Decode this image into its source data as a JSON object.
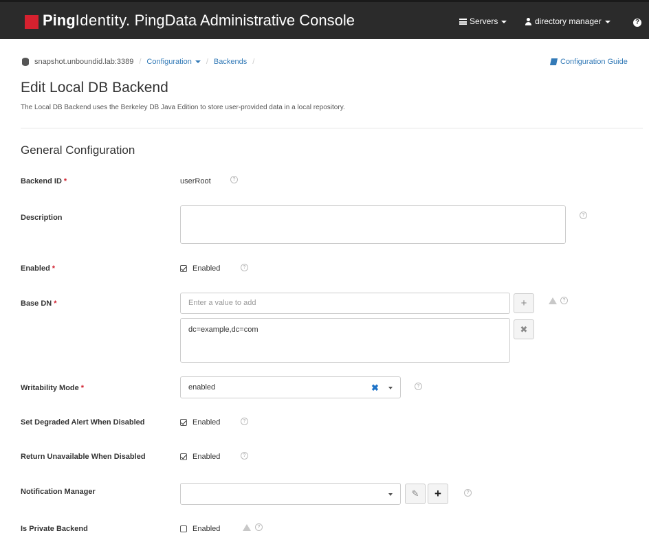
{
  "navbar": {
    "brand_bold": "Ping",
    "brand_light": "Identity.",
    "app_title": "PingData Administrative Console",
    "servers_label": "Servers",
    "user_label": "directory manager",
    "icons": [
      "servers-icon",
      "user-icon",
      "help-icon"
    ]
  },
  "breadcrumb": {
    "server": "snapshot.unboundid.lab:3389",
    "configuration": "Configuration",
    "backends": "Backends"
  },
  "guide_link": "Configuration Guide",
  "page": {
    "title": "Edit Local DB Backend",
    "subtitle": "The Local DB Backend uses the Berkeley DB Java Edition to store user-provided data in a local repository.",
    "section": "General Configuration"
  },
  "fields": {
    "backend_id": {
      "label": "Backend ID",
      "value": "userRoot"
    },
    "description": {
      "label": "Description",
      "value": ""
    },
    "enabled": {
      "label": "Enabled",
      "checkbox_label": "Enabled",
      "checked": true
    },
    "base_dn": {
      "label": "Base DN",
      "placeholder": "Enter a value to add",
      "values": [
        "dc=example,dc=com"
      ]
    },
    "writability_mode": {
      "label": "Writability Mode",
      "value": "enabled"
    },
    "set_degraded_alert": {
      "label": "Set Degraded Alert When Disabled",
      "checkbox_label": "Enabled",
      "checked": true
    },
    "return_unavailable": {
      "label": "Return Unavailable When Disabled",
      "checkbox_label": "Enabled",
      "checked": true
    },
    "notification_manager": {
      "label": "Notification Manager",
      "value": ""
    },
    "is_private_backend": {
      "label": "Is Private Backend",
      "checkbox_label": "Enabled",
      "checked": false
    }
  },
  "required_marker": "*",
  "colors": {
    "navbar": "#2b2b2b",
    "brand_red": "#d6212f",
    "link": "#337ab7",
    "required": "#d01f2e"
  }
}
